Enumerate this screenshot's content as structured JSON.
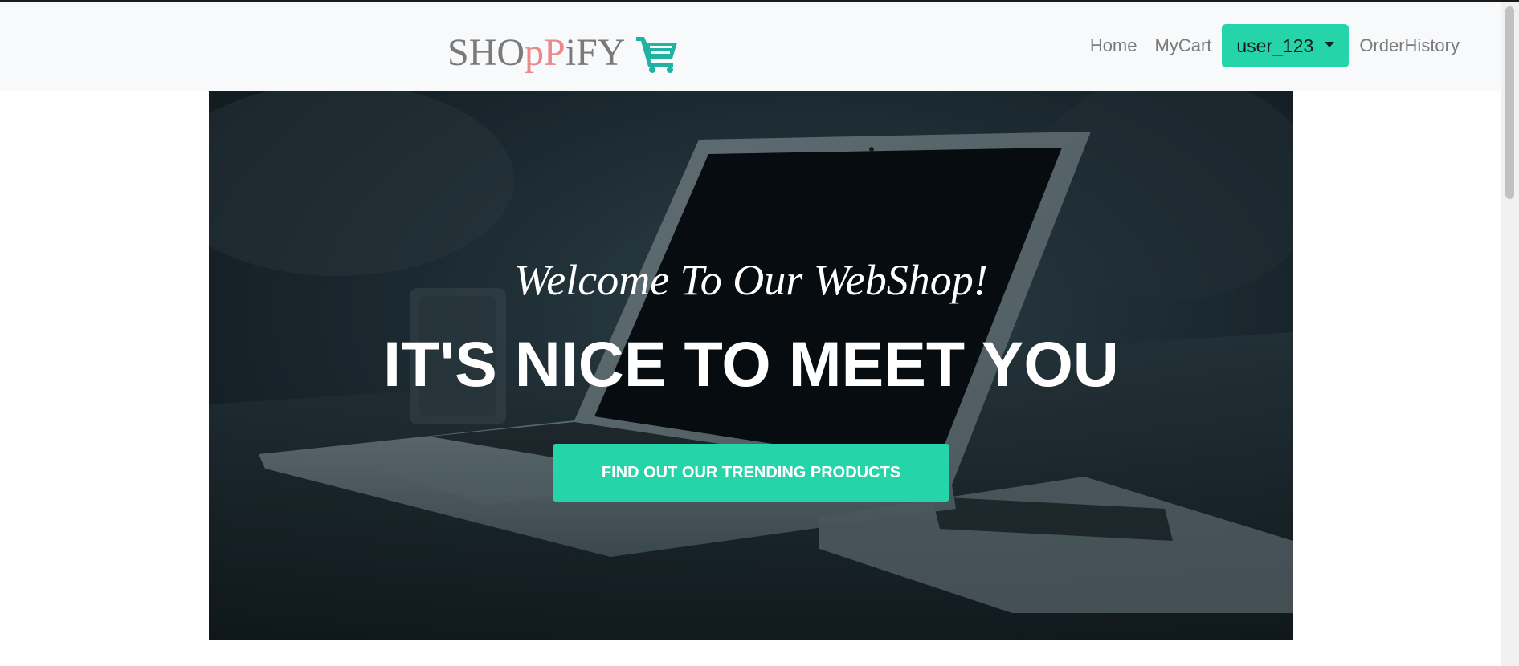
{
  "navbar": {
    "brand": {
      "part1": "SHO",
      "part2": "pP",
      "part3": "iFY"
    },
    "links": {
      "home": "Home",
      "mycart": "MyCart",
      "user": "user_123",
      "order_history": "OrderHistory"
    }
  },
  "hero": {
    "subtitle": "Welcome To Our WebShop!",
    "title": "IT'S NICE TO MEET YOU",
    "button_label": "FIND OUT OUR TRENDING PRODUCTS"
  },
  "icons": {
    "cart": "shopping-cart-icon",
    "dropdown": "caret-down-icon"
  },
  "colors": {
    "accent": "#26d4aa",
    "brand_gray": "#7a7a7a",
    "brand_pink": "#e88a8a",
    "nav_background": "#f8f9fa",
    "nav_link": "#7b7b7b"
  }
}
